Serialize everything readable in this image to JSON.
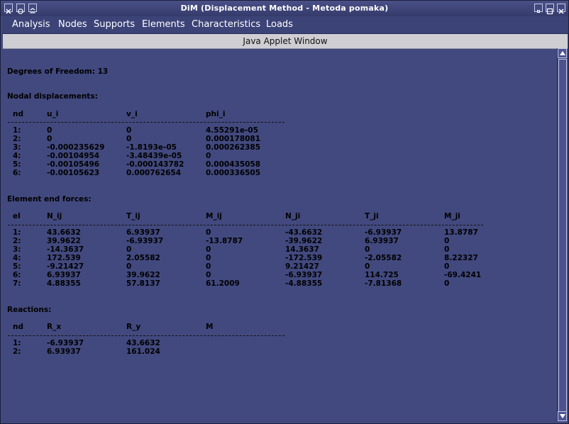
{
  "window": {
    "title": "DiM (Displacement Method - Metoda pomaka)"
  },
  "menu": {
    "items": [
      "Analysis",
      "Nodes",
      "Supports",
      "Elements",
      "Characteristics",
      "Loads"
    ]
  },
  "applet_label": "Java Applet Window",
  "report": {
    "dof": "Degrees of Freedom: 13",
    "nodal": {
      "title": "Nodal displacements:",
      "headers": [
        "nd",
        "u_i",
        "v_i",
        "phi_i"
      ],
      "rows": [
        [
          "1:",
          "0",
          "0",
          "4.55291e-05"
        ],
        [
          "2:",
          "0",
          "0",
          "0.000178081"
        ],
        [
          "3:",
          "-0.000235629",
          "-1.8193e-05",
          "0.000262385"
        ],
        [
          "4:",
          "-0.00104954",
          "-3.48439e-05",
          "0"
        ],
        [
          "5:",
          "-0.00105496",
          "-0.000143782",
          "0.000435058"
        ],
        [
          "6:",
          "-0.00105623",
          "0.000762654",
          "0.000336505"
        ]
      ]
    },
    "forces": {
      "title": "Element end forces:",
      "headers": [
        "el",
        "N_ij",
        "T_ij",
        "M_ij",
        "N_ji",
        "T_ji",
        "M_ji"
      ],
      "rows": [
        [
          "1:",
          "43.6632",
          "6.93937",
          "0",
          "-43.6632",
          "-6.93937",
          "13.8787"
        ],
        [
          "2:",
          "39.9622",
          "-6.93937",
          "-13.8787",
          "-39.9622",
          "6.93937",
          "0"
        ],
        [
          "3:",
          "-14.3637",
          "0",
          "0",
          "14.3637",
          "0",
          "0"
        ],
        [
          "4:",
          "172.539",
          "2.05582",
          "0",
          "-172.539",
          "-2.05582",
          "8.22327"
        ],
        [
          "5:",
          "-9.21427",
          "0",
          "0",
          "9.21427",
          "0",
          "0"
        ],
        [
          "6:",
          "6.93937",
          "39.9622",
          "0",
          "-6.93937",
          "114.725",
          "-69.4241"
        ],
        [
          "7:",
          "4.88355",
          "57.8137",
          "61.2009",
          "-4.88355",
          "-7.81368",
          "0"
        ]
      ]
    },
    "reactions": {
      "title": "Reactions:",
      "headers": [
        "nd",
        "R_x",
        "R_y",
        "M"
      ],
      "rows": [
        [
          "1:",
          "-6.93937",
          "43.6632",
          ""
        ],
        [
          "2:",
          "6.93937",
          "161.024",
          ""
        ]
      ]
    }
  }
}
